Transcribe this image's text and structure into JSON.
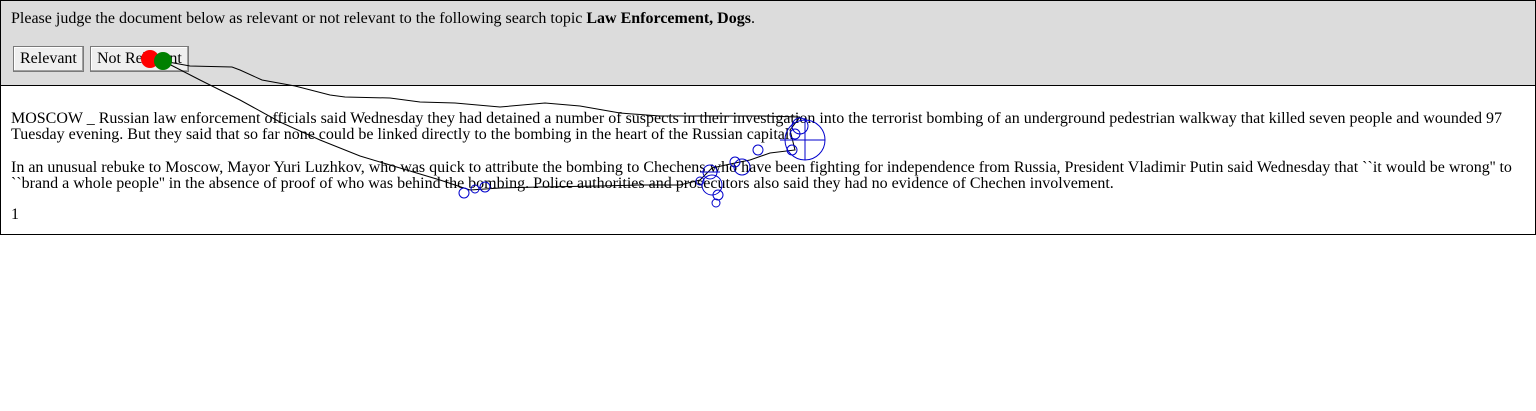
{
  "instruction": {
    "prefix": "Please judge the document below as relevant or not relevant to the following search topic ",
    "topic": "Law Enforcement, Dogs",
    "suffix": "."
  },
  "buttons": {
    "relevant": "Relevant",
    "not_relevant": "Not Relevant"
  },
  "document": {
    "paragraph1": "MOSCOW _ Russian law enforcement officials said Wednesday they had detained a number of suspects in their investigation into the terrorist bombing of an underground pedestrian walkway that killed seven people and wounded 97 Tuesday evening. But they said that so far none could be linked directly to the bombing in the heart of the Russian capital.",
    "paragraph2": "In an unusual rebuke to Moscow, Mayor Yuri Luzhkov, who was quick to attribute the bombing to Chechens who have been fighting for independence from Russia, President Vladimir Putin said Wednesday that ``it would be wrong'' to ``brand a whole people'' in the absence of proof of who was behind the bombing. Police authorities and prosecutors also said they had no evidence of Chechen involvement.",
    "page_number": "1"
  },
  "overlay_colors": {
    "fixation": "#0000cc",
    "path": "#000000",
    "start_marker": "#ff0000",
    "end_marker": "#008000"
  }
}
